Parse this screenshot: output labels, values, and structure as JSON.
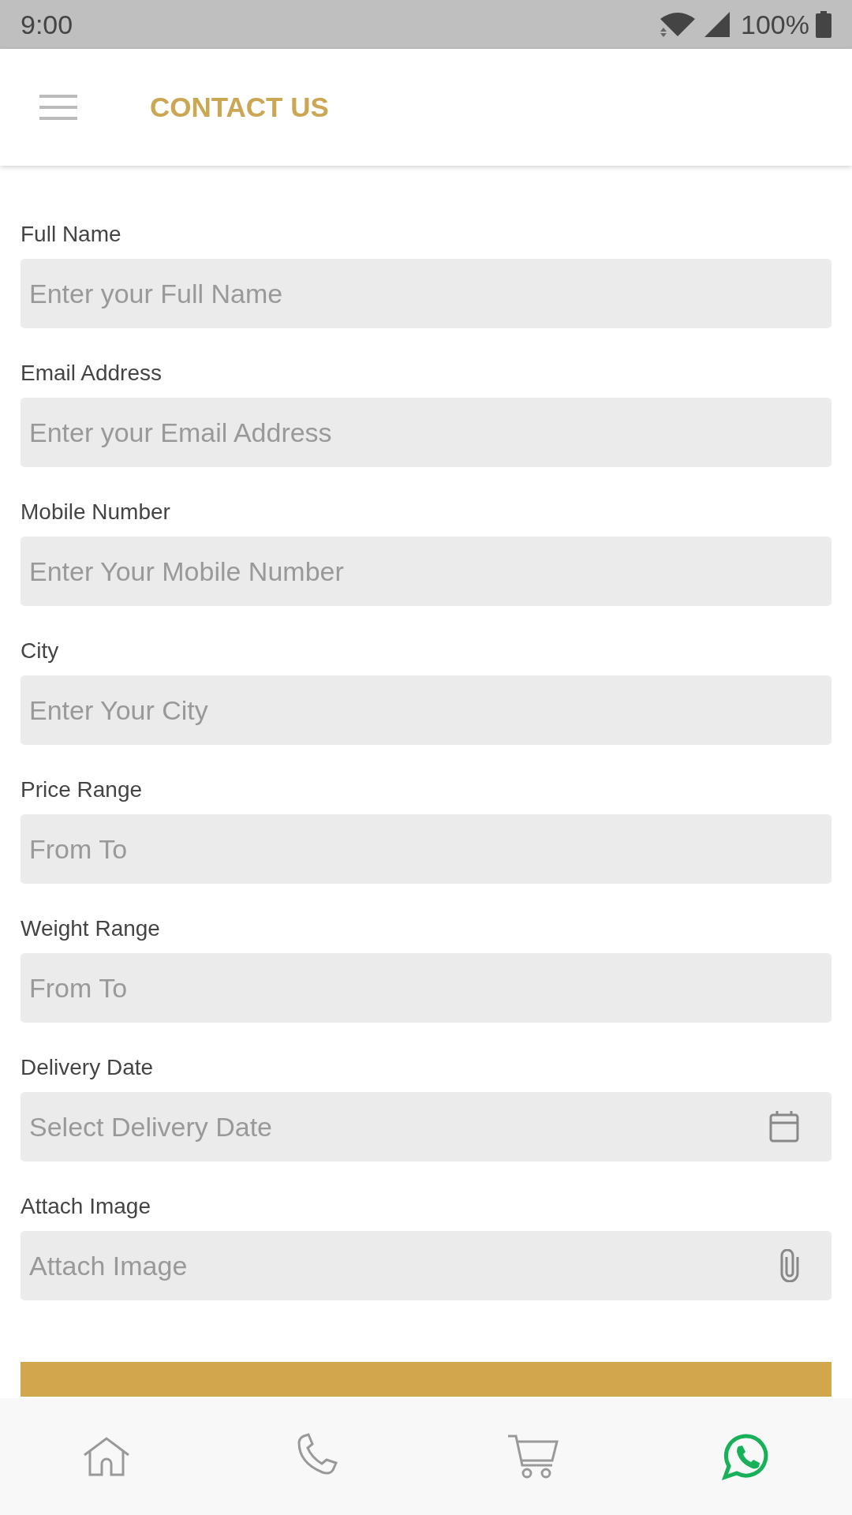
{
  "status_bar": {
    "time": "9:00",
    "battery": "100%"
  },
  "header": {
    "title": "CONTACT US"
  },
  "fields": [
    {
      "kind": "text",
      "label": "Full Name",
      "placeholder": "Enter your Full Name"
    },
    {
      "kind": "text",
      "label": "Email Address",
      "placeholder": "Enter your Email Address"
    },
    {
      "kind": "text",
      "label": "Mobile Number",
      "placeholder": "Enter Your Mobile Number"
    },
    {
      "kind": "text",
      "label": "City",
      "placeholder": "Enter Your City"
    },
    {
      "kind": "text",
      "label": "Price Range",
      "placeholder": "From To"
    },
    {
      "kind": "text",
      "label": "Weight Range",
      "placeholder": "From To"
    },
    {
      "kind": "date",
      "label": "Delivery Date",
      "placeholder": "Select Delivery Date"
    },
    {
      "kind": "file",
      "label": "Attach Image",
      "placeholder": "Attach Image"
    }
  ],
  "bottom_nav": [
    {
      "kind": "home"
    },
    {
      "kind": "phone"
    },
    {
      "kind": "cart"
    },
    {
      "kind": "chat"
    }
  ]
}
